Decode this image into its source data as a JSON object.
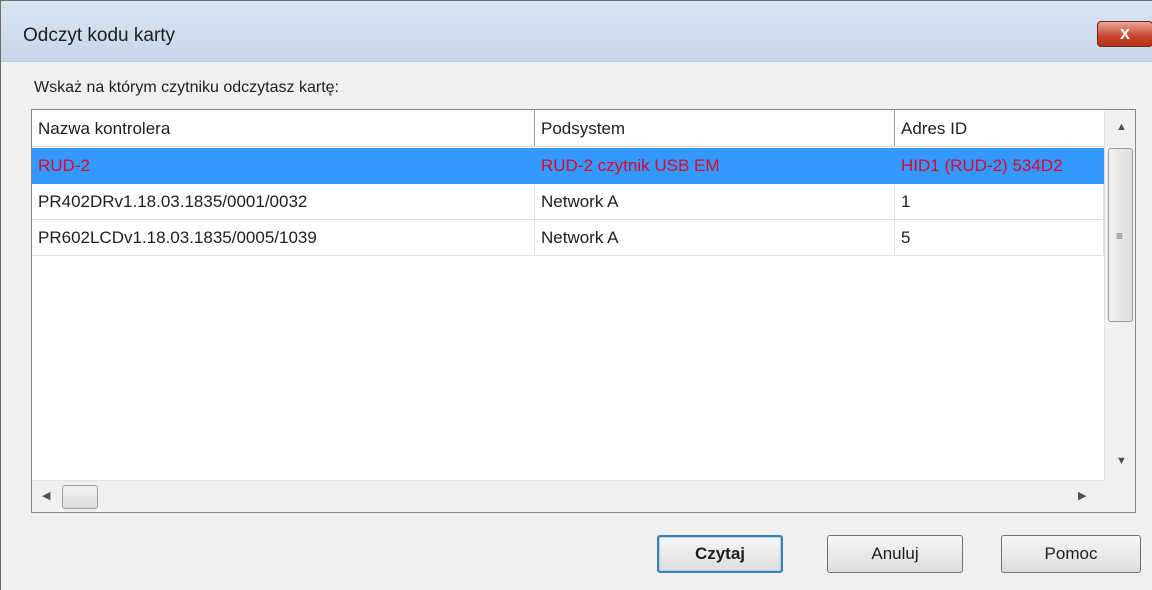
{
  "window": {
    "title": "Odczyt kodu karty",
    "close_symbol": "x"
  },
  "instruction": "Wskaż na którym czytniku odczytasz kartę:",
  "table": {
    "columns": [
      "Nazwa kontrolera",
      "Podsystem",
      "Adres ID"
    ],
    "rows": [
      [
        "RUD-2",
        "RUD-2 czytnik USB EM",
        "HID1 (RUD-2) 534D2"
      ],
      [
        "PR402DRv1.18.03.1835/0001/0032",
        "Network A",
        "1"
      ],
      [
        "PR602LCDv1.18.03.1835/0005/1039",
        "Network A",
        "5"
      ]
    ],
    "selected_row": 0
  },
  "buttons": {
    "read": "Czytaj",
    "cancel": "Anuluj",
    "help": "Pomoc"
  },
  "colors": {
    "selection": "#3399ff",
    "selected_text": "#e4002b"
  }
}
